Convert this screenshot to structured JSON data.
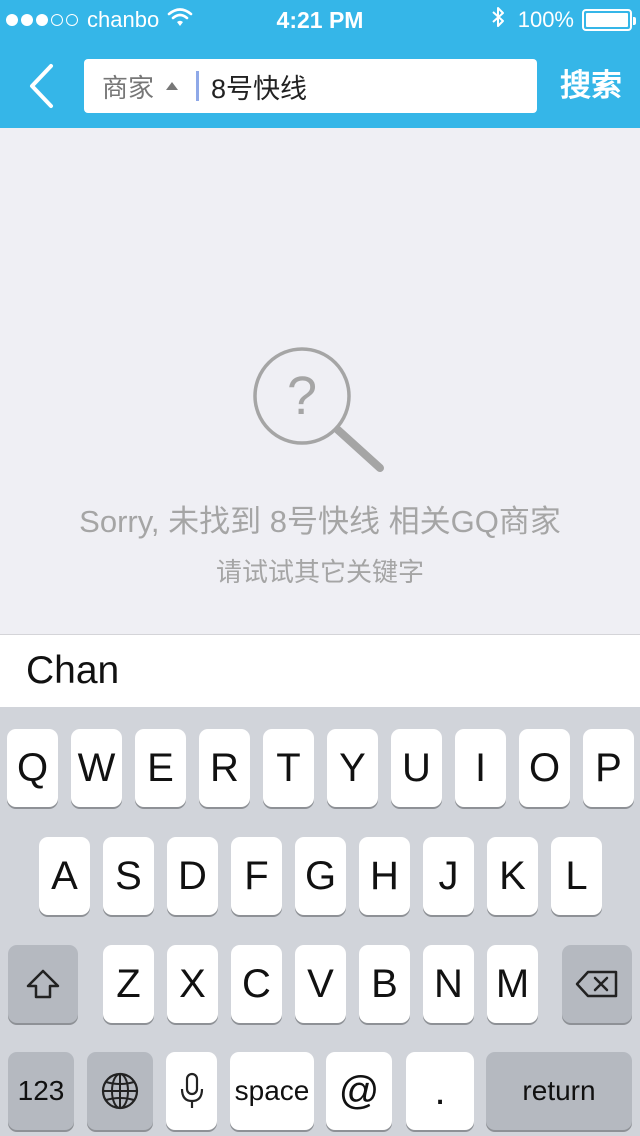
{
  "status_bar": {
    "carrier": "chanbo",
    "time": "4:21 PM",
    "battery": "100%",
    "battery_level": 1.0,
    "signal_bars": 3,
    "signal_total": 5
  },
  "navbar": {
    "scope_label": "商家",
    "query": "8号快线",
    "search_label": "搜索"
  },
  "empty_state": {
    "icon": "question-search-icon",
    "message": "Sorry, 未找到 8号快线 相关GQ商家",
    "hint": "请试试其它关键字"
  },
  "suggestion": "Chan",
  "keyboard": {
    "row1": [
      "Q",
      "W",
      "E",
      "R",
      "T",
      "Y",
      "U",
      "I",
      "O",
      "P"
    ],
    "row2": [
      "A",
      "S",
      "D",
      "F",
      "G",
      "H",
      "J",
      "K",
      "L"
    ],
    "row3": [
      "Z",
      "X",
      "C",
      "V",
      "B",
      "N",
      "M"
    ],
    "numbers_label": "123",
    "space_label": "space",
    "at_label": "@",
    "dot_label": ".",
    "return_label": "return"
  },
  "colors": {
    "accent": "#35b6e8",
    "background": "#efeff4",
    "muted_text": "#a5a5a5",
    "keyboard_bg": "#d1d4da"
  }
}
